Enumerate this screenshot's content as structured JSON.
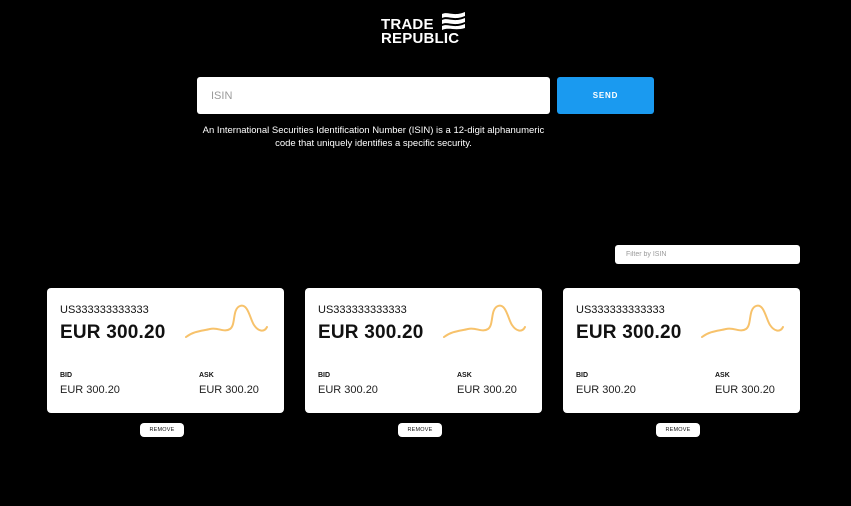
{
  "brand": {
    "line1": "TRADE",
    "line2": "REPUBLIC"
  },
  "search": {
    "placeholder": "ISIN",
    "value": "",
    "send_label": "SEND",
    "description": "An International Securities Identification Number (ISIN) is a 12-digit alphanumeric code that uniquely identifies a specific security."
  },
  "filter": {
    "placeholder": "Filter by ISIN",
    "value": ""
  },
  "cards": [
    {
      "isin": "US333333333333",
      "price": "EUR 300.20",
      "bid_label": "BID",
      "bid": "EUR 300.20",
      "ask_label": "ASK",
      "ask": "EUR 300.20",
      "remove_label": "REMOVE"
    },
    {
      "isin": "US333333333333",
      "price": "EUR 300.20",
      "bid_label": "BID",
      "bid": "EUR 300.20",
      "ask_label": "ASK",
      "ask": "EUR 300.20",
      "remove_label": "REMOVE"
    },
    {
      "isin": "US333333333333",
      "price": "EUR 300.20",
      "bid_label": "BID",
      "bid": "EUR 300.20",
      "ask_label": "ASK",
      "ask": "EUR 300.20",
      "remove_label": "REMOVE"
    }
  ],
  "colors": {
    "background": "#000000",
    "accent": "#1a9af0",
    "sparkline": "#f7c26b",
    "card": "#ffffff"
  },
  "icons": {
    "brand_flag": "flag-icon",
    "sparkline": "sparkline-icon"
  }
}
